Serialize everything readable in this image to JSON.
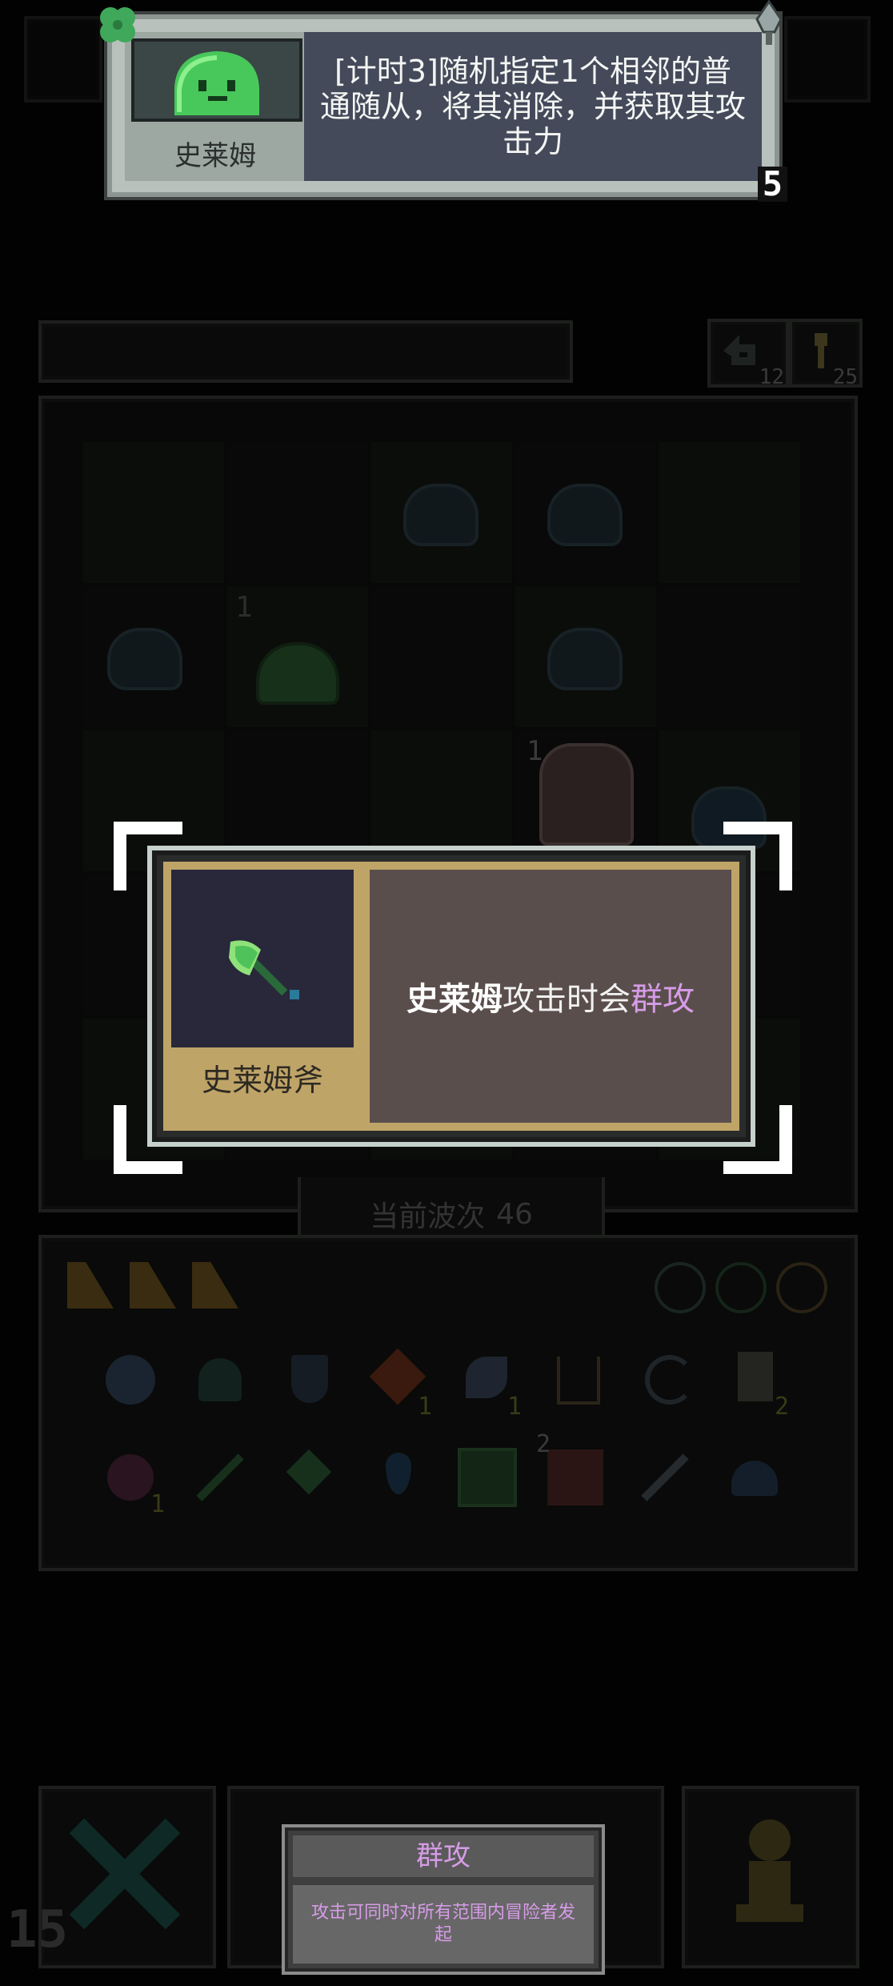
{
  "top_card": {
    "unit_name": "史莱姆",
    "description": "[计时3]随机指定1个相邻的普通随从，将其消除，并获取其攻击力",
    "count": "5"
  },
  "header_counters": {
    "left_value": "12",
    "right_value": "25"
  },
  "board": {
    "slime_level": "1",
    "hero_level": "1"
  },
  "wave": {
    "label": "当前波次",
    "value": "46"
  },
  "inventory": {
    "badges": [
      "1",
      "1",
      "2",
      "1",
      "2"
    ]
  },
  "popup": {
    "item_name": "史莱姆斧",
    "effect_subject": "史莱姆",
    "effect_middle": "攻击时会",
    "effect_keyword": "群攻"
  },
  "tooltip": {
    "title": "群攻",
    "body": "攻击可同时对所有范围内冒险者发起"
  },
  "bottom_bar": {
    "timer": "15"
  },
  "colors": {
    "keyword": "#d79ce8",
    "slime_green": "#48c85a",
    "popup_gold": "#bfa468"
  }
}
